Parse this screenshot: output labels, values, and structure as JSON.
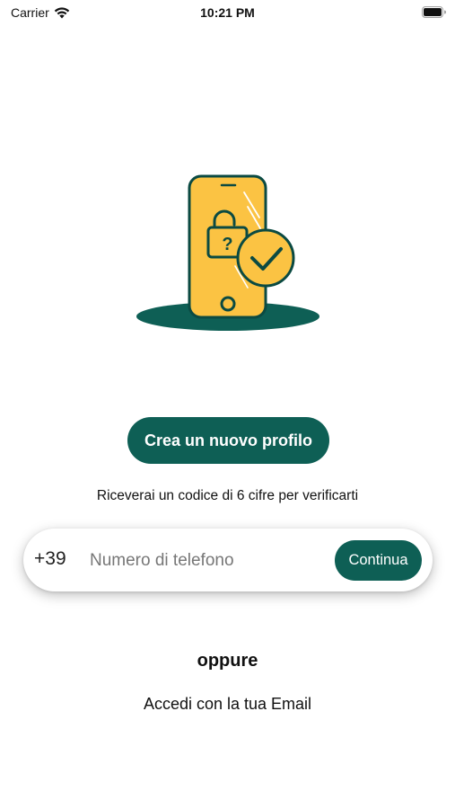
{
  "status_bar": {
    "carrier": "Carrier",
    "time": "10:21 PM"
  },
  "illustration": {
    "icon": "phone-verification-icon",
    "colors": {
      "phone": "#FBC343",
      "accent": "#0E5F55",
      "outline": "#0B4A42"
    }
  },
  "create_profile_button": {
    "label": "Crea un nuovo profilo"
  },
  "hint": "Riceverai un codice di 6 cifre per verificarti",
  "phone_form": {
    "prefix": "+39",
    "placeholder": "Numero di telefono",
    "value": "",
    "continue_label": "Continua"
  },
  "divider_text": "oppure",
  "email_login_label": "Accedi con la tua Email",
  "colors": {
    "primary": "#0E5F55",
    "background": "#FFFFFF"
  }
}
